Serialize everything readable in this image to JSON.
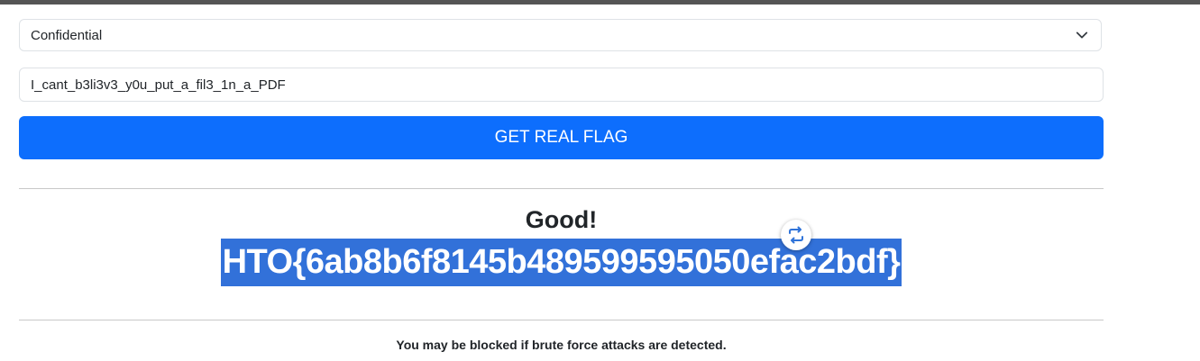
{
  "form": {
    "category_select": {
      "selected": "Confidential",
      "icon": "chevron-down-icon"
    },
    "flag_input": {
      "value": "I_cant_b3li3v3_y0u_put_a_fil3_1n_a_PDF"
    },
    "submit_label": "GET REAL FLAG",
    "accent_color": "#0d6efd"
  },
  "result": {
    "heading": "Good!",
    "flag": "HTO{6ab8b6f8145b489599595050efac2bdf}",
    "selection_color": "#3271d9",
    "overlay_icon": "translate-icon"
  },
  "footer": {
    "warning": "You may be blocked if brute force attacks are detected."
  }
}
